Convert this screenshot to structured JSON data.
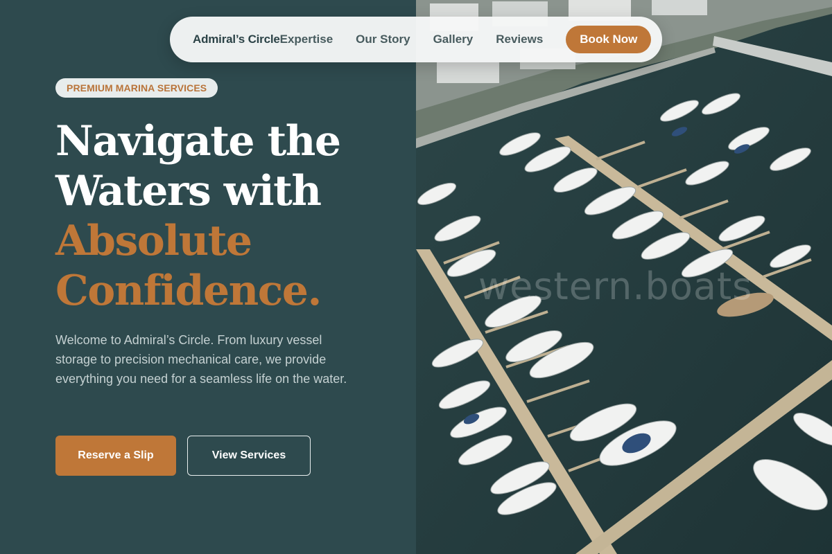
{
  "nav": {
    "brand": "Admiral’s Circle",
    "links": [
      "Expertise",
      "Our Story",
      "Gallery",
      "Reviews"
    ],
    "cta": "Book Now"
  },
  "hero": {
    "badge": "PREMIUM MARINA SERVICES",
    "headline": {
      "line1": "Navigate the",
      "line2": "Waters with",
      "accent1": "Absolute",
      "accent2": "Confidence."
    },
    "intro": "Welcome to Admiral’s Circle. From luxury vessel storage to precision mechanical care, we provide everything you need for a seamless life on the water.",
    "primary_cta": "Reserve a Slip",
    "secondary_cta": "View Services"
  },
  "photo": {
    "watermark": "western.boats"
  },
  "colors": {
    "panel": "#2e4a4e",
    "accent": "#bf7738",
    "nav_bg": "#f6f7f7",
    "water": "#24393c"
  }
}
